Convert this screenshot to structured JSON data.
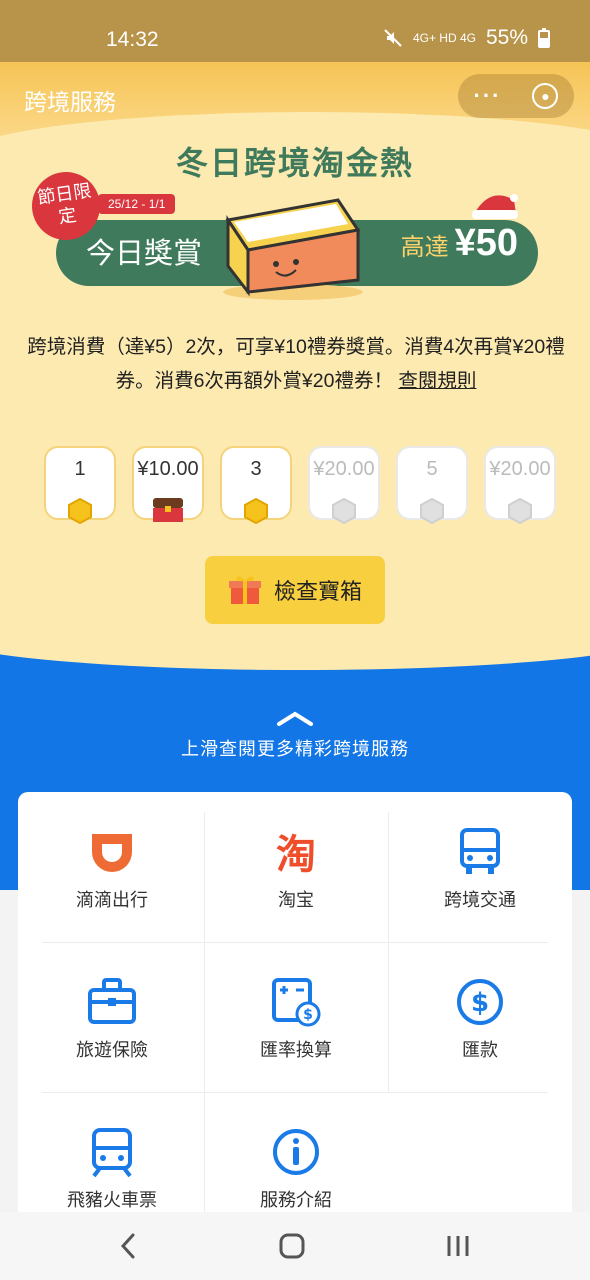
{
  "status_bar": {
    "time": "14:32",
    "network": "4G+ HD 4G",
    "battery": "55%"
  },
  "header": {
    "title": "跨境服務",
    "menu_icon": "more-dots-icon",
    "close_icon": "close-circle-icon"
  },
  "banner": {
    "event_title": "冬日跨境淘金熱",
    "badge": "節日限定",
    "date_range": "25/12 - 1/1",
    "today_reward_label": "今日獎賞",
    "max_prefix": "高達",
    "max_value": "¥50"
  },
  "description": {
    "text": "跨境消費（達¥5）2次，可享¥10禮券獎賞。消費4次再賞¥20禮券。消費6次再額外賞¥20禮券！",
    "rules_link": "查閱規則"
  },
  "progress_steps": [
    {
      "label": "1",
      "marker": "coin-icon",
      "active": true
    },
    {
      "label": "¥10.00",
      "marker": "chest-icon",
      "active": true
    },
    {
      "label": "3",
      "marker": "coin-icon",
      "active": true
    },
    {
      "label": "¥20.00",
      "marker": "grey-coin-icon",
      "active": false
    },
    {
      "label": "5",
      "marker": "grey-coin-icon",
      "active": false
    },
    {
      "label": "¥20.00",
      "marker": "grey-coin-icon",
      "active": false
    }
  ],
  "check_button": {
    "label": "檢查寶箱",
    "icon": "gift-icon"
  },
  "swipe_hint": "上滑查閱更多精彩跨境服務",
  "services": [
    {
      "label": "滴滴出行",
      "icon": "didi-icon",
      "color": "#ef6b35"
    },
    {
      "label": "淘宝",
      "icon": "taobao-icon",
      "color": "#f04e2a"
    },
    {
      "label": "跨境交通",
      "icon": "bus-icon",
      "color": "#1a7be8"
    },
    {
      "label": "旅遊保險",
      "icon": "briefcase-icon",
      "color": "#1a7be8"
    },
    {
      "label": "匯率換算",
      "icon": "calculator-icon",
      "color": "#1a7be8"
    },
    {
      "label": "匯款",
      "icon": "dollar-circle-icon",
      "color": "#1a7be8"
    },
    {
      "label": "飛豬火車票",
      "icon": "train-icon",
      "color": "#1a7be8"
    },
    {
      "label": "服務介紹",
      "icon": "info-icon",
      "color": "#1a7be8"
    }
  ],
  "colors": {
    "accent_green": "#3f7a5c",
    "accent_yellow": "#f8cf3e",
    "brand_blue": "#1276e6",
    "badge_red": "#d9363e"
  }
}
